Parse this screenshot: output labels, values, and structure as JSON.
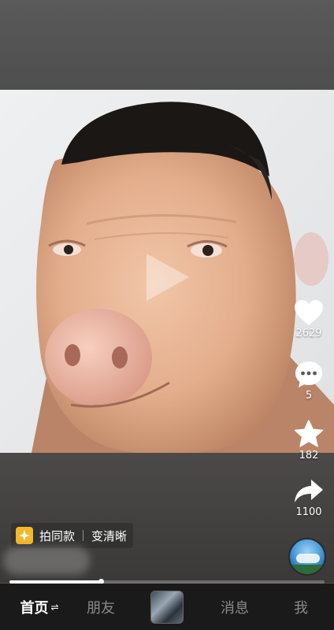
{
  "video": {
    "subject_icon": "pig-face-with-hair"
  },
  "actions": {
    "like_count": "2629",
    "comment_count": "5",
    "favorite_count": "182",
    "share_count": "1100"
  },
  "template_bar": {
    "same_style_label": "拍同款",
    "enhance_label": "变清晰"
  },
  "progress": {
    "played_fraction": 0.29
  },
  "nav": {
    "home": "首页",
    "home_switch": "⇌",
    "friends": "朋友",
    "messages": "消息",
    "me": "我"
  },
  "colors": {
    "accent_yellow": "#f4b92b",
    "nav_background": "#1a1a1a"
  }
}
